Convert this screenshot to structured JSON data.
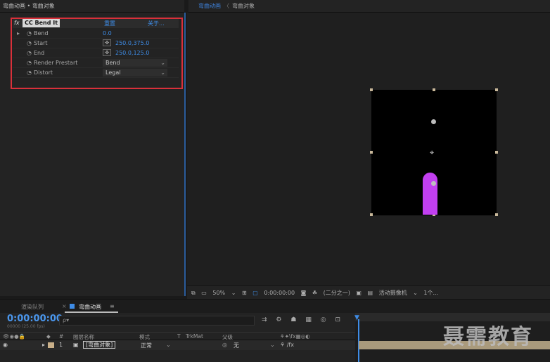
{
  "left_panel": {
    "title": "弯曲动画 • 弯曲对象"
  },
  "viewer": {
    "tab_active": "弯曲动画",
    "tab_sep": "〈",
    "tab_other": "弯曲对象"
  },
  "effect": {
    "fx_icon": "fx",
    "name": "CC Bend It",
    "reset_label": "重置",
    "about_label": "关于...",
    "properties": [
      {
        "label": "Bend",
        "value": "0.0",
        "type": "number"
      },
      {
        "label": "Start",
        "value": "250.0,375.0",
        "type": "point"
      },
      {
        "label": "End",
        "value": "250.0,125.0",
        "type": "point"
      },
      {
        "label": "Render Prestart",
        "value": "Bend",
        "type": "dropdown"
      },
      {
        "label": "Distort",
        "value": "Legal",
        "type": "dropdown"
      }
    ]
  },
  "viewer_bar": {
    "zoom": "50%",
    "timecode": "0:00:00:00",
    "resolution": "(二分之一)",
    "camera": "活动摄像机",
    "views": "1个..."
  },
  "timeline": {
    "tab_render": "渲染队列",
    "tab_comp": "弯曲动画",
    "tab_menu": "≡",
    "timecode": "0:00:00:00",
    "fps": "00000 (25.00 fps)",
    "search_icon_text": "ρ▾",
    "header": {
      "number": "#",
      "layer_name": "图层名称",
      "mode": "模式",
      "t": "T",
      "trkmat": "TrkMat",
      "parent": "父级"
    },
    "layer": {
      "index": "1",
      "name": "[弯曲对象]",
      "mode": "正常",
      "parent": "无"
    }
  },
  "watermark": "聂需教育",
  "colors": {
    "accent_blue": "#3e8ce6",
    "highlight_red": "#d9303a",
    "shape_purple": "#c23ff0"
  }
}
